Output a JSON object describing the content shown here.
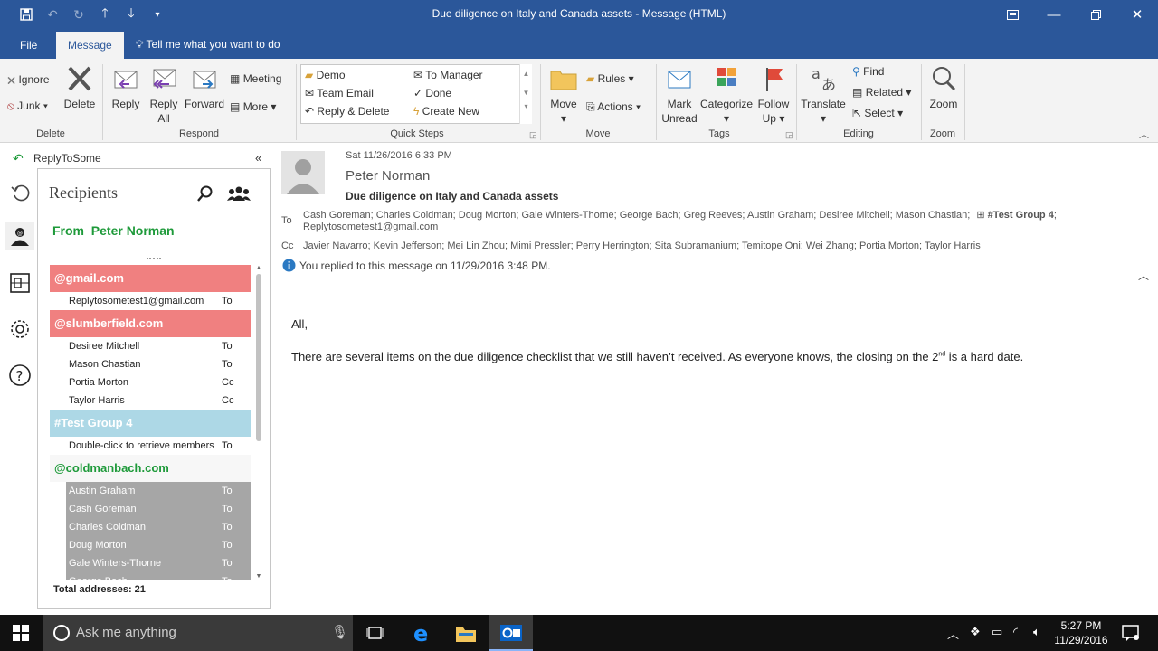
{
  "window": {
    "title": "Due diligence on Italy and Canada assets - Message (HTML)"
  },
  "tabs": {
    "file": "File",
    "message": "Message",
    "tell_me": "Tell me what you want to do"
  },
  "ribbon": {
    "delete_group": {
      "ignore": "Ignore",
      "junk": "Junk",
      "delete": "Delete",
      "label": "Delete"
    },
    "respond_group": {
      "reply": "Reply",
      "reply_all_1": "Reply",
      "reply_all_2": "All",
      "forward": "Forward",
      "meeting": "Meeting",
      "more": "More",
      "label": "Respond"
    },
    "quick_steps": {
      "items": [
        "Demo",
        "To Manager",
        "Team Email",
        "Done",
        "Reply & Delete",
        "Create New"
      ],
      "label": "Quick Steps"
    },
    "move_group": {
      "move": "Move",
      "rules": "Rules",
      "actions": "Actions",
      "label": "Move"
    },
    "tags_group": {
      "mark_unread_1": "Mark",
      "mark_unread_2": "Unread",
      "categorize": "Categorize",
      "follow_up_1": "Follow",
      "follow_up_2": "Up",
      "label": "Tags"
    },
    "editing_group": {
      "translate": "Translate",
      "find": "Find",
      "related": "Related",
      "select": "Select",
      "label": "Editing"
    },
    "zoom_group": {
      "zoom": "Zoom",
      "label": "Zoom"
    }
  },
  "addin": {
    "name": "ReplyToSome",
    "panel_title": "Recipients",
    "from_label": "From",
    "from_name": "Peter Norman",
    "groups": [
      {
        "name": "@gmail.com",
        "rows": [
          {
            "name": "Replytosometest1@gmail.com",
            "type": "To"
          }
        ]
      },
      {
        "name": "@slumberfield.com",
        "rows": [
          {
            "name": "Desiree Mitchell",
            "type": "To"
          },
          {
            "name": "Mason Chastian",
            "type": "To"
          },
          {
            "name": "Portia Morton",
            "type": "Cc"
          },
          {
            "name": "Taylor Harris",
            "type": "Cc"
          }
        ]
      },
      {
        "name": "#Test Group 4",
        "rows": [
          {
            "name": "Double-click to retrieve members",
            "type": "To"
          }
        ]
      },
      {
        "name": "@coldmanbach.com",
        "rows": [
          {
            "name": "Austin Graham",
            "type": "To"
          },
          {
            "name": "Cash Goreman",
            "type": "To"
          },
          {
            "name": "Charles Coldman",
            "type": "To"
          },
          {
            "name": "Doug Morton",
            "type": "To"
          },
          {
            "name": "Gale Winters-Thorne",
            "type": "To"
          },
          {
            "name": "George Bach",
            "type": "To"
          }
        ]
      }
    ],
    "total": "Total addresses: 21",
    "colors": {
      "red_group": "#f08080",
      "blue_group": "#add8e6",
      "green_text": "#1e9a3a",
      "selected_row": "#a6a6a6"
    }
  },
  "message": {
    "date": "Sat 11/26/2016 6:33 PM",
    "sender": "Peter Norman",
    "subject": "Due diligence on Italy and Canada assets",
    "to_label": "To",
    "to_list": "Cash Goreman; Charles Coldman; Doug Morton; Gale Winters-Thorne; George Bach; Greg Reeves; Austin Graham; Desiree Mitchell; Mason Chastian;",
    "to_group": "#Test Group 4",
    "to_list_2": "Replytosometest1@gmail.com",
    "cc_label": "Cc",
    "cc_list": "Javier Navarro; Kevin Jefferson; Mei Lin Zhou; Mimi Pressler; Perry Herrington; Sita Subramanium; Temitope Oni; Wei Zhang; Portia Morton; Taylor Harris",
    "info": "You replied to this message on 11/29/2016 3:48 PM.",
    "greeting": "All,",
    "body_before": "There are several items on the due diligence checklist that we still haven’t received. As everyone knows, the closing on the 2",
    "body_sup": "nd",
    "body_after": " is a hard date."
  },
  "taskbar": {
    "search_placeholder": "Ask me anything",
    "time": "5:27 PM",
    "date": "11/29/2016"
  }
}
